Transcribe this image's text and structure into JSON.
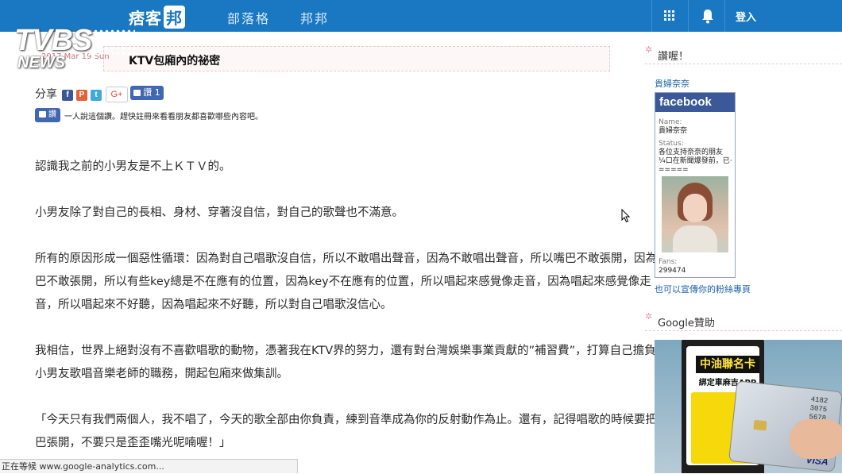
{
  "header": {
    "site_name": "痞客",
    "site_badge": "邦",
    "nav": [
      "部落格",
      "邦邦"
    ],
    "login_label": "登入",
    "icons": [
      "grid-icon",
      "bell-icon"
    ]
  },
  "watermark": {
    "brand": "TVBS",
    "sub": "NEWS"
  },
  "post": {
    "date": "2017 Mar 19 Sun",
    "title": "KTV包廂內的祕密",
    "share_label": "分享",
    "share_buttons": [
      "f",
      "P",
      "t"
    ],
    "gplus_label": "G+",
    "like_label": "讚 1",
    "like_label_small": "讚",
    "like_note": "一人說這個讚。趕快註冊來看看朋友都喜歡哪些內容吧。",
    "paragraphs": [
      "認識我之前的小男友是不上ＫＴＶ的。",
      "小男友除了對自己的長相、身材、穿著沒自信，對自己的歌聲也不滿意。",
      "所有的原因形成一個惡性循環：因為對自己唱歌沒自信，所以不敢唱出聲音，因為不敢唱出聲音，所以嘴巴不敢張開，因為嘴",
      "巴不敢張開，所以有些key總是不在應有的位置，因為key不在應有的位置，所以唱起來感覺像走音，因為唱起來感覺像走",
      "音，所以唱起來不好聽，因為唱起來不好聽，所以對自己唱歌沒信心。",
      "我相信，世界上絕對沒有不喜歡唱歌的動物，憑著我在KTV界的努力，還有對台灣娛樂事業貢獻的”補習費”，打算自己擔負起",
      "小男友歌唱音樂老師的職務，開起包廂來做集訓。",
      "「今天只有我們兩個人，我不唱了，今天的歌全部由你負責，練到音準成為你的反射動作為止。還有，記得唱歌的時候要把嘴",
      "巴張開，不要只是歪歪嘴光呢喃喔！」"
    ]
  },
  "sidebar": {
    "like_head": "讚喔！",
    "page_link": "貴婦奈奈",
    "facebook": {
      "logo": "facebook",
      "name_label": "Name:",
      "name": "貴婦奈奈",
      "status_label": "Status:",
      "status_lines": [
        "各位支持奈奈的朋友",
        "¼口在新聞爆發前，已·",
        "====="
      ],
      "fans_label": "Fans:",
      "fans": "299474"
    },
    "promote_link": "也可以宣傳你的粉絲專頁",
    "google_head": "Google贊助",
    "ad": {
      "title": "中油聯名卡",
      "subtitle": "綁定車麻吉APP",
      "card_number": [
        "4182",
        "3075",
        "5678"
      ],
      "card_brand": "VISA"
    }
  },
  "statusbar": {
    "text": "正在等候 www.google-analytics.com..."
  }
}
